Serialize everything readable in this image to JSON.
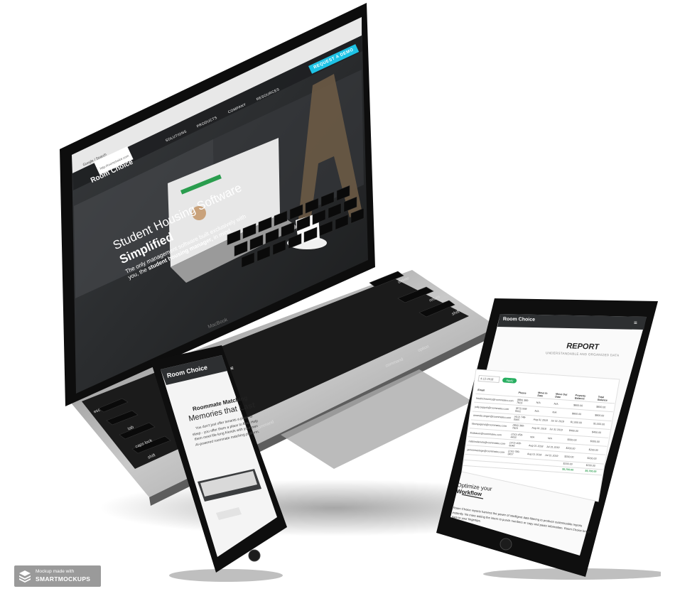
{
  "laptop": {
    "browser": {
      "tab_title": "Google / Search",
      "address": "http://roomchoice.com",
      "request_demo_label": "REQUEST A DEMO"
    },
    "site": {
      "brand": "Room Choice",
      "nav": [
        "SOLUTIONS",
        "PRODUCTS",
        "COMPANY",
        "RESOURCES"
      ],
      "hero_title": "Student Housing Software",
      "hero_title_bold": "Simplified",
      "hero_sub_line1": "The only management software built exclusively with",
      "hero_sub_line2_prefix": "you, the ",
      "hero_sub_line2_bold": "student housing manager,",
      "hero_sub_line2_suffix": " in mind."
    },
    "macbook_label": "MacBook",
    "keys": [
      "delete",
      "return",
      "shift",
      "option",
      "command",
      "command",
      "esc",
      "tab",
      "caps lock",
      "shift",
      "control",
      "option"
    ]
  },
  "phone": {
    "brand": "Room Choice",
    "heading": "Roommate Matching",
    "tagline_prefix": "Memories that ",
    "tagline_bold": "Last",
    "body_line1": "You don't just offer tenants a place to",
    "body_line2_prefix": "sleep - you offer them a place to ",
    "body_line2_bold": "live",
    "body_line2_suffix": ". Help",
    "body_line3": "them meet life-long friends with your own",
    "body_line4": "AI-powered roommate matching platform."
  },
  "tablet": {
    "brand": "Room Choice",
    "report_title": "REPORT",
    "report_sub": "UNDERSTANDABLE AND ORGANIZED DATA",
    "date_value": "4-12-2018",
    "apply_label": "Apply",
    "columns": [
      "Email",
      "Phone",
      "Move In Date",
      "Move Out Date",
      "Property Balance",
      "Total Balance"
    ],
    "rows": [
      [
        "friedrichmorris@roommateu.com",
        "(880) 380-7823",
        "N/A",
        "N/A",
        "$800.00",
        "$800.00"
      ],
      [
        "judy.zeppoli@roommateu.com",
        "(872) 558-9031",
        "N/A",
        "N/A",
        "$800.00",
        "$800.00"
      ],
      [
        "amanda.singer@roommateu.com",
        "(412) 748-0065",
        "Aug 01 2018",
        "Jul 31 2019",
        "$1,000.00",
        "$1,000.00"
      ],
      [
        "tiborquigan4@roommateu.com",
        "(850) 380-7823",
        "Aug 01 2018",
        "Jul 31 2019",
        "$400.00",
        "$400.00"
      ],
      [
        "lindaauer@roommateu.com",
        "(210) 458-4453",
        "N/A",
        "N/A",
        "$300.00",
        "$300.00"
      ],
      [
        "ralstondaniels@roommateu.com",
        "(372) 408-6046",
        "Aug 01 2018",
        "Jul 31 2019",
        "$200.00",
        "$200.00"
      ],
      [
        "jamesmastuge@roommateu.com",
        "(210) 789-3457",
        "Aug 01 2018",
        "Jul 31 2019",
        "$200.00",
        "$200.00"
      ],
      [
        "",
        "",
        "",
        "",
        "$200.00",
        "$200.00"
      ]
    ],
    "totals": [
      "$5,700.00",
      "$5,700.00"
    ],
    "optimize_line1": "Optimize your",
    "optimize_line2": "Workflow",
    "body_line1": "Room Choice reports harness the power of intelligent data filtering to produce customizable reports",
    "body_line2": "instantly. No more asking the intern to punch numbers or copy and paste information. Room Choice brings",
    "body_line3": "data to your fingertips."
  },
  "watermark": {
    "line1": "Mockup made with",
    "line2": "SMARTMOCKUPS"
  },
  "colors": {
    "accent_cyan": "#1ec3e6",
    "device_black": "#101010",
    "apply_green": "#27ae60",
    "totals_green": "#2a9d4e"
  },
  "icons": {
    "hamburger": "menu-icon",
    "watermark_logo": "stacked-layers-icon"
  }
}
